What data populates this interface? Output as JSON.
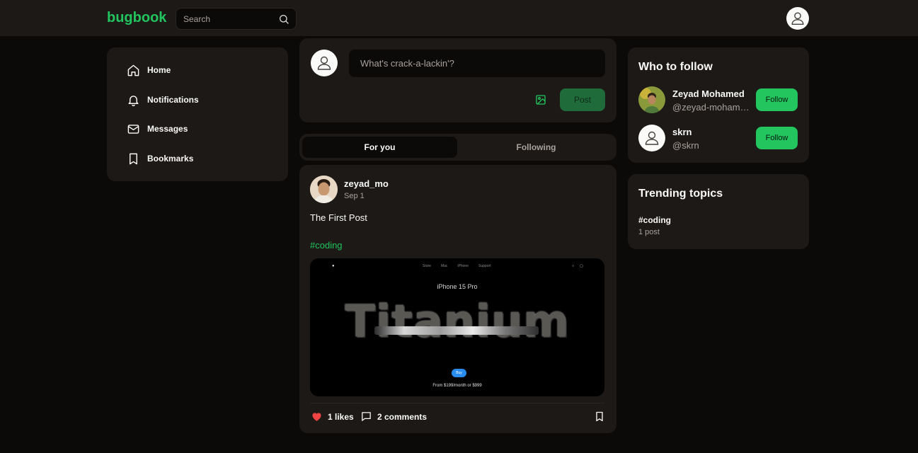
{
  "header": {
    "logo": "bugbook",
    "search_placeholder": "Search",
    "search_icon": "search-icon",
    "avatar_icon": "user-icon"
  },
  "nav": {
    "items": [
      {
        "label": "Home",
        "icon": "home-icon"
      },
      {
        "label": "Notifications",
        "icon": "bell-icon"
      },
      {
        "label": "Messages",
        "icon": "mail-icon"
      },
      {
        "label": "Bookmarks",
        "icon": "bookmark-icon"
      }
    ]
  },
  "composer": {
    "placeholder": "What's crack-a-lackin'?",
    "post_label": "Post",
    "image_icon": "image-icon"
  },
  "tabs": [
    {
      "label": "For you",
      "active": true
    },
    {
      "label": "Following",
      "active": false
    }
  ],
  "post": {
    "author": "zeyad_mo",
    "date": "Sep 1",
    "text": "The First Post",
    "hashtag": "#coding",
    "image": {
      "nav_links": [
        "Store",
        "Mac",
        "iPhone",
        "Support"
      ],
      "title": "iPhone 15 Pro",
      "hero": "Titanium",
      "buy_label": "Buy",
      "price": "From $199/month or $999"
    },
    "likes": "1 likes",
    "comments": "2 comments"
  },
  "who_to_follow": {
    "title": "Who to follow",
    "users": [
      {
        "name": "Zeyad Mohamed",
        "handle": "@zeyad-mohamed",
        "button": "Follow"
      },
      {
        "name": "skrn",
        "handle": "@skrn",
        "button": "Follow"
      }
    ]
  },
  "trending": {
    "title": "Trending topics",
    "topics": [
      {
        "tag": "#coding",
        "count": "1 post"
      }
    ]
  },
  "colors": {
    "accent": "#22c55e",
    "background": "#0c0a09",
    "panel": "#1c1917",
    "muted_text": "#a8a29e",
    "like": "#ef4444"
  }
}
